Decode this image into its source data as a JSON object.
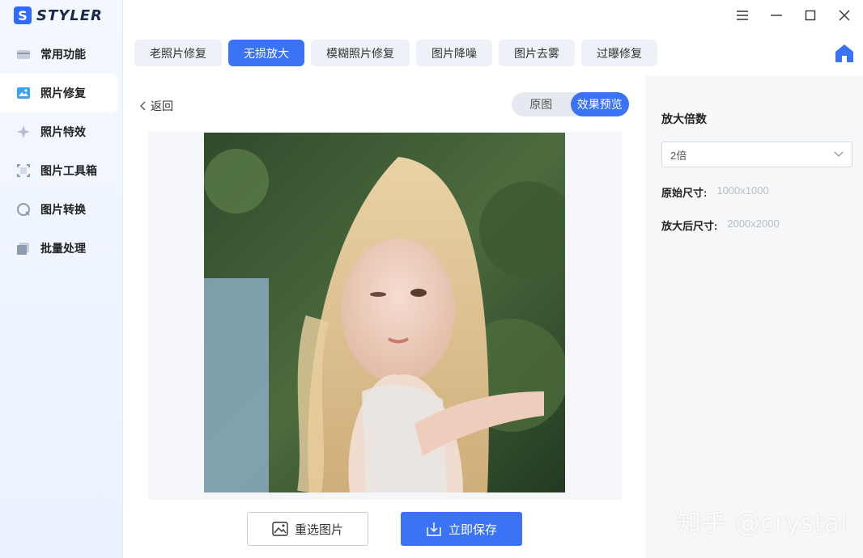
{
  "app": {
    "logo_letter": "S",
    "logo_text": "STYLER"
  },
  "sidebar": {
    "items": [
      {
        "label": "常用功能",
        "icon": "toolbox-icon"
      },
      {
        "label": "照片修复",
        "icon": "photo-icon"
      },
      {
        "label": "照片特效",
        "icon": "sparkle-icon"
      },
      {
        "label": "图片工具箱",
        "icon": "crop-icon"
      },
      {
        "label": "图片转换",
        "icon": "convert-icon"
      },
      {
        "label": "批量处理",
        "icon": "batch-icon"
      }
    ]
  },
  "tabs": [
    {
      "label": "老照片修复"
    },
    {
      "label": "无损放大"
    },
    {
      "label": "模糊照片修复"
    },
    {
      "label": "图片降噪"
    },
    {
      "label": "图片去雾"
    },
    {
      "label": "过曝修复"
    }
  ],
  "main": {
    "back_label": "返回",
    "toggle": {
      "original": "原图",
      "preview": "效果预览"
    },
    "reselect_label": "重选图片",
    "save_label": "立即保存"
  },
  "panel": {
    "title": "放大倍数",
    "scale_value": "2倍",
    "original_size_label": "原始尺寸:",
    "original_size_value": "1000x1000",
    "enlarged_size_label": "放大后尺寸:",
    "enlarged_size_value": "2000x2000"
  },
  "watermark": "知乎 @crystal",
  "colors": {
    "accent": "#3a73f5",
    "panel_bg": "#f6f7f9",
    "sidebar_bg": "#eef4ff"
  }
}
